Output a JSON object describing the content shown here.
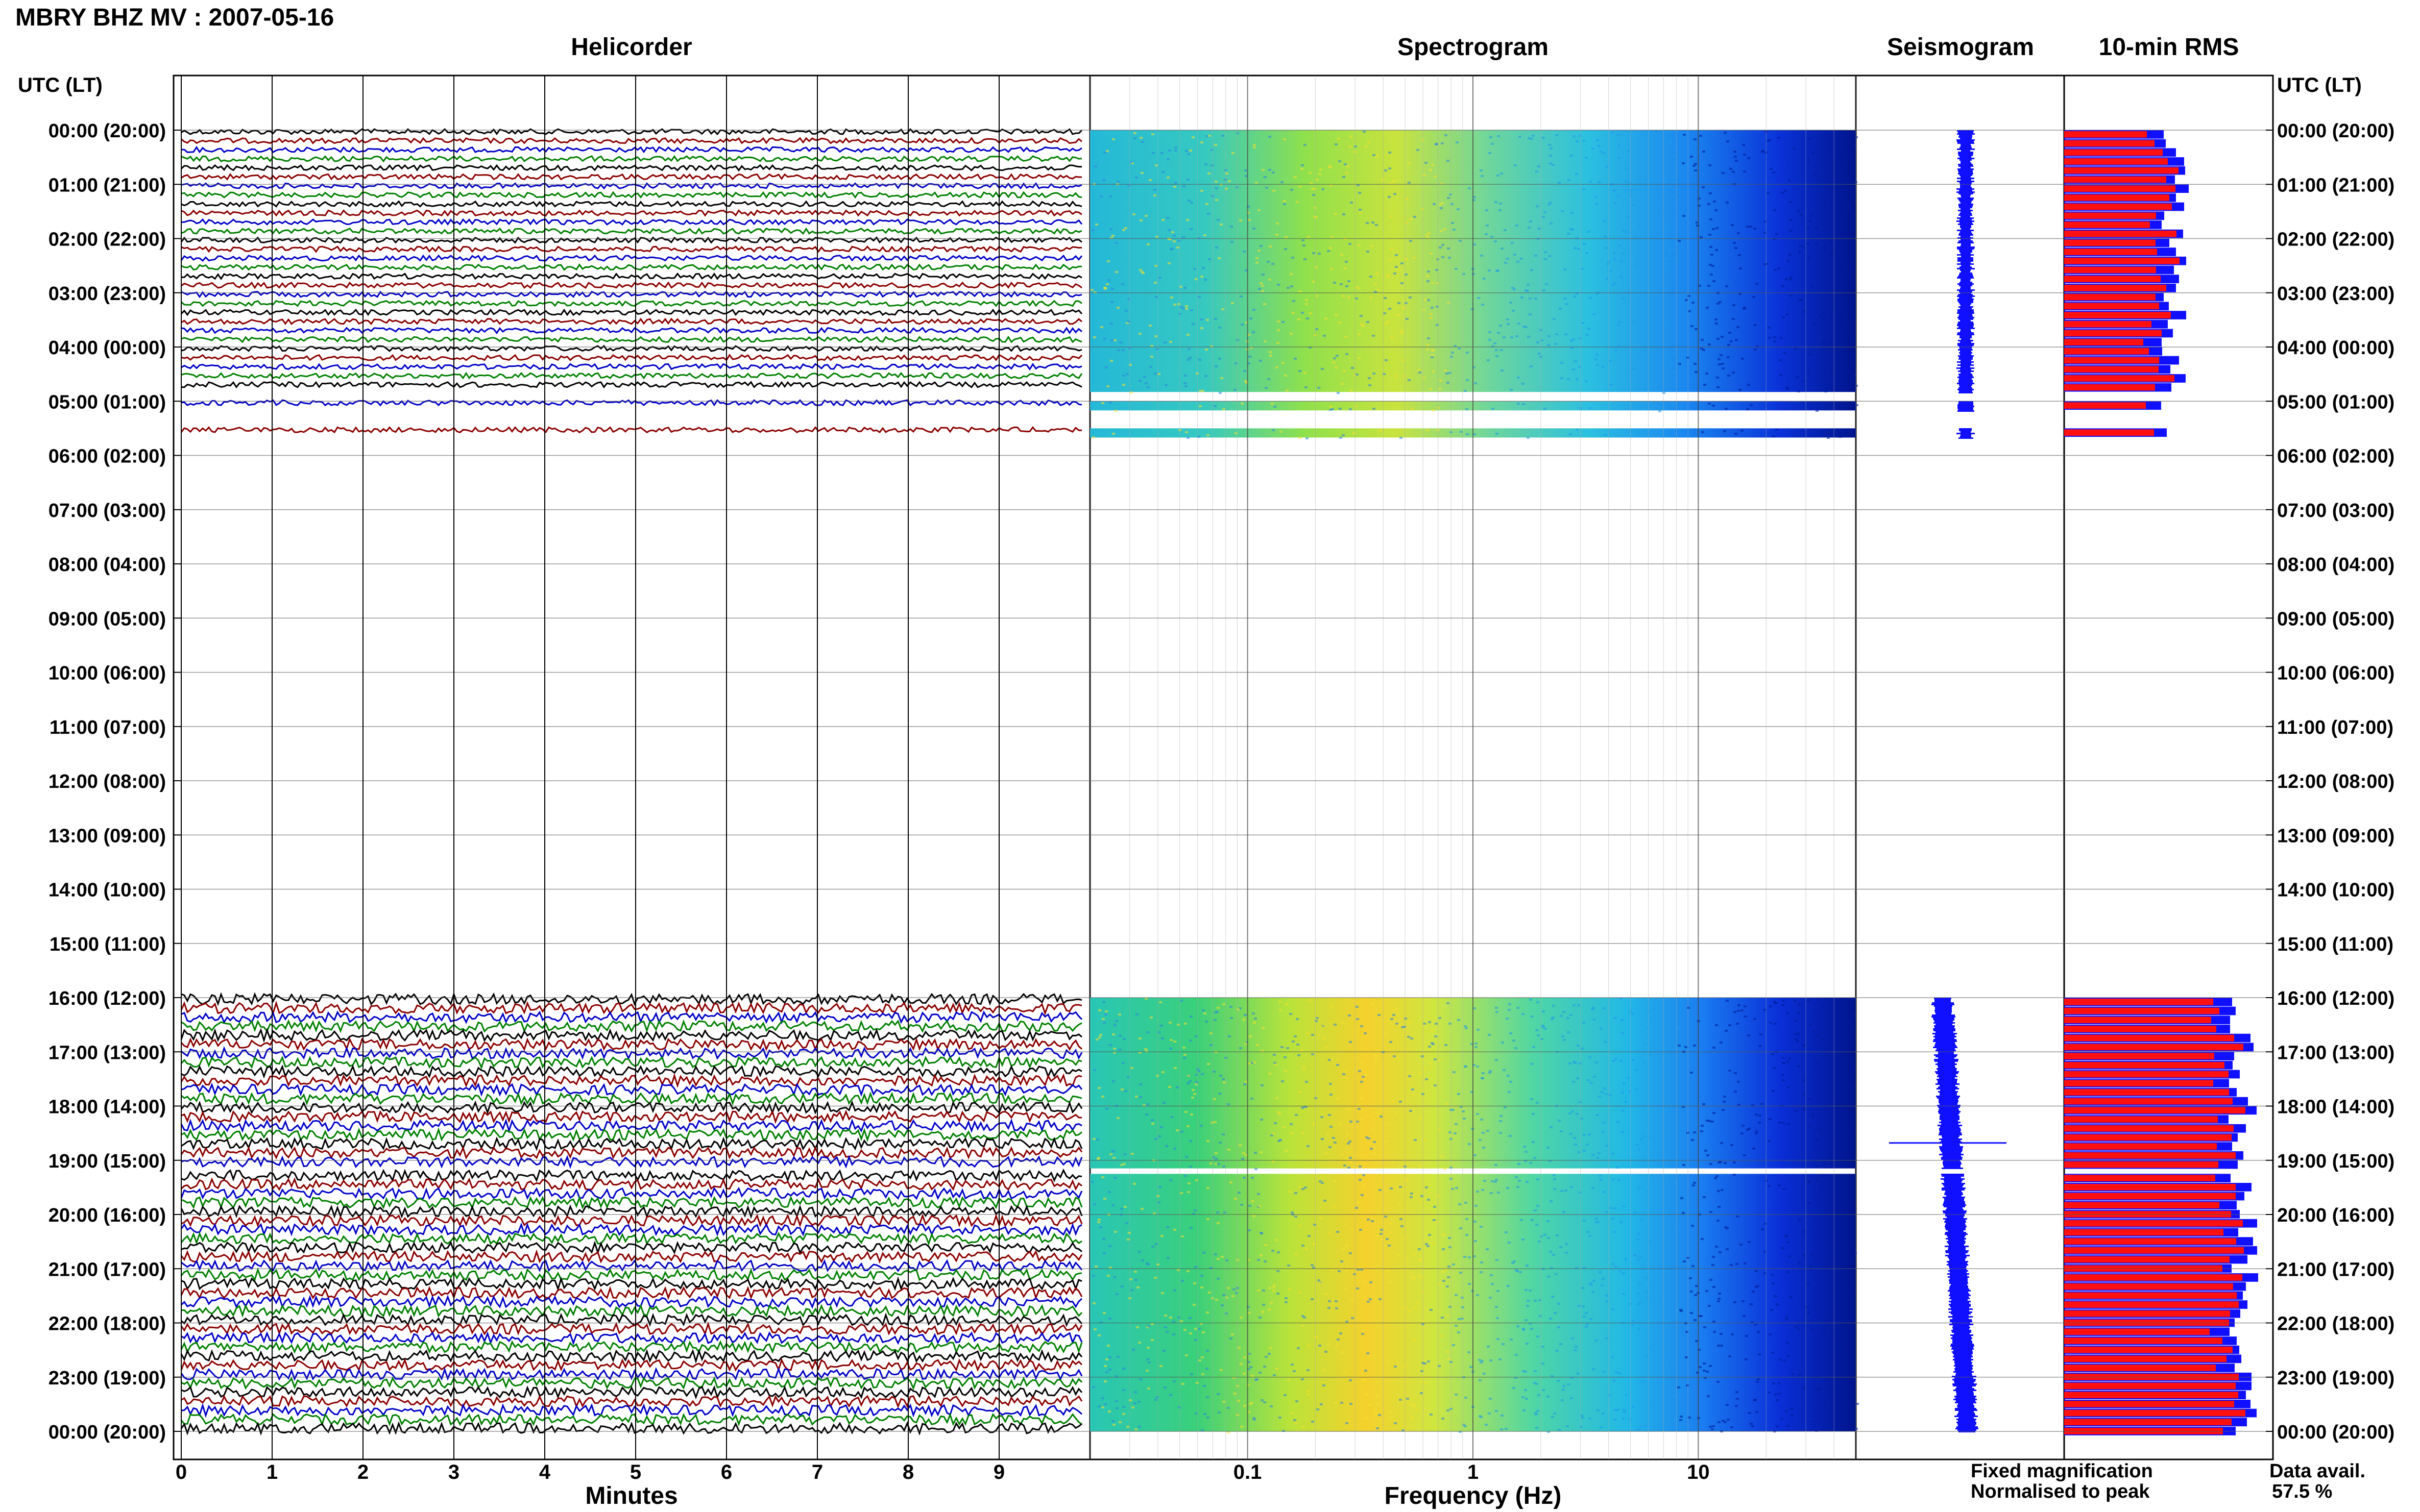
{
  "title": "MBRY BHZ MV : 2007-05-16",
  "axis_header": "UTC (LT)",
  "panels": {
    "helicorder": "Helicorder",
    "spectrogram": "Spectrogram",
    "seismogram": "Seismogram",
    "rms": "10-min RMS"
  },
  "xlabels": {
    "helicorder": "Minutes",
    "spectrogram": "Frequency (Hz)"
  },
  "legend": {
    "fixed": "Fixed magnification",
    "normalised": "Normalised to peak",
    "fixed_color": "#1010ff",
    "normalised_color": "#ff1010"
  },
  "availability": {
    "label": "Data avail.",
    "value": "57.5 %"
  },
  "chart_data": {
    "type": "heatmap",
    "time_labels": [
      "00:00 (20:00)",
      "01:00 (21:00)",
      "02:00 (22:00)",
      "03:00 (23:00)",
      "04:00 (00:00)",
      "05:00 (01:00)",
      "06:00 (02:00)",
      "07:00 (03:00)",
      "08:00 (04:00)",
      "09:00 (05:00)",
      "10:00 (06:00)",
      "11:00 (07:00)",
      "12:00 (08:00)",
      "13:00 (09:00)",
      "14:00 (10:00)",
      "15:00 (11:00)",
      "16:00 (12:00)",
      "17:00 (13:00)",
      "18:00 (14:00)",
      "19:00 (15:00)",
      "20:00 (16:00)",
      "21:00 (17:00)",
      "22:00 (18:00)",
      "23:00 (19:00)",
      "00:00 (20:00)"
    ],
    "minute_ticks": [
      "0",
      "1",
      "2",
      "3",
      "4",
      "5",
      "6",
      "7",
      "8",
      "9"
    ],
    "freq_ticks": [
      "0.1",
      "1",
      "10"
    ],
    "freq_range_hz": [
      0.02,
      50
    ],
    "trace_colors": [
      "#000000",
      "#8b0000",
      "#0000c8",
      "#008000"
    ],
    "data_segments_hours": [
      [
        0,
        4.83
      ],
      [
        5.0,
        5.17
      ],
      [
        5.5,
        5.67
      ],
      [
        16.0,
        19.15
      ],
      [
        19.25,
        24.0
      ]
    ],
    "availability_percent": 57.5
  }
}
